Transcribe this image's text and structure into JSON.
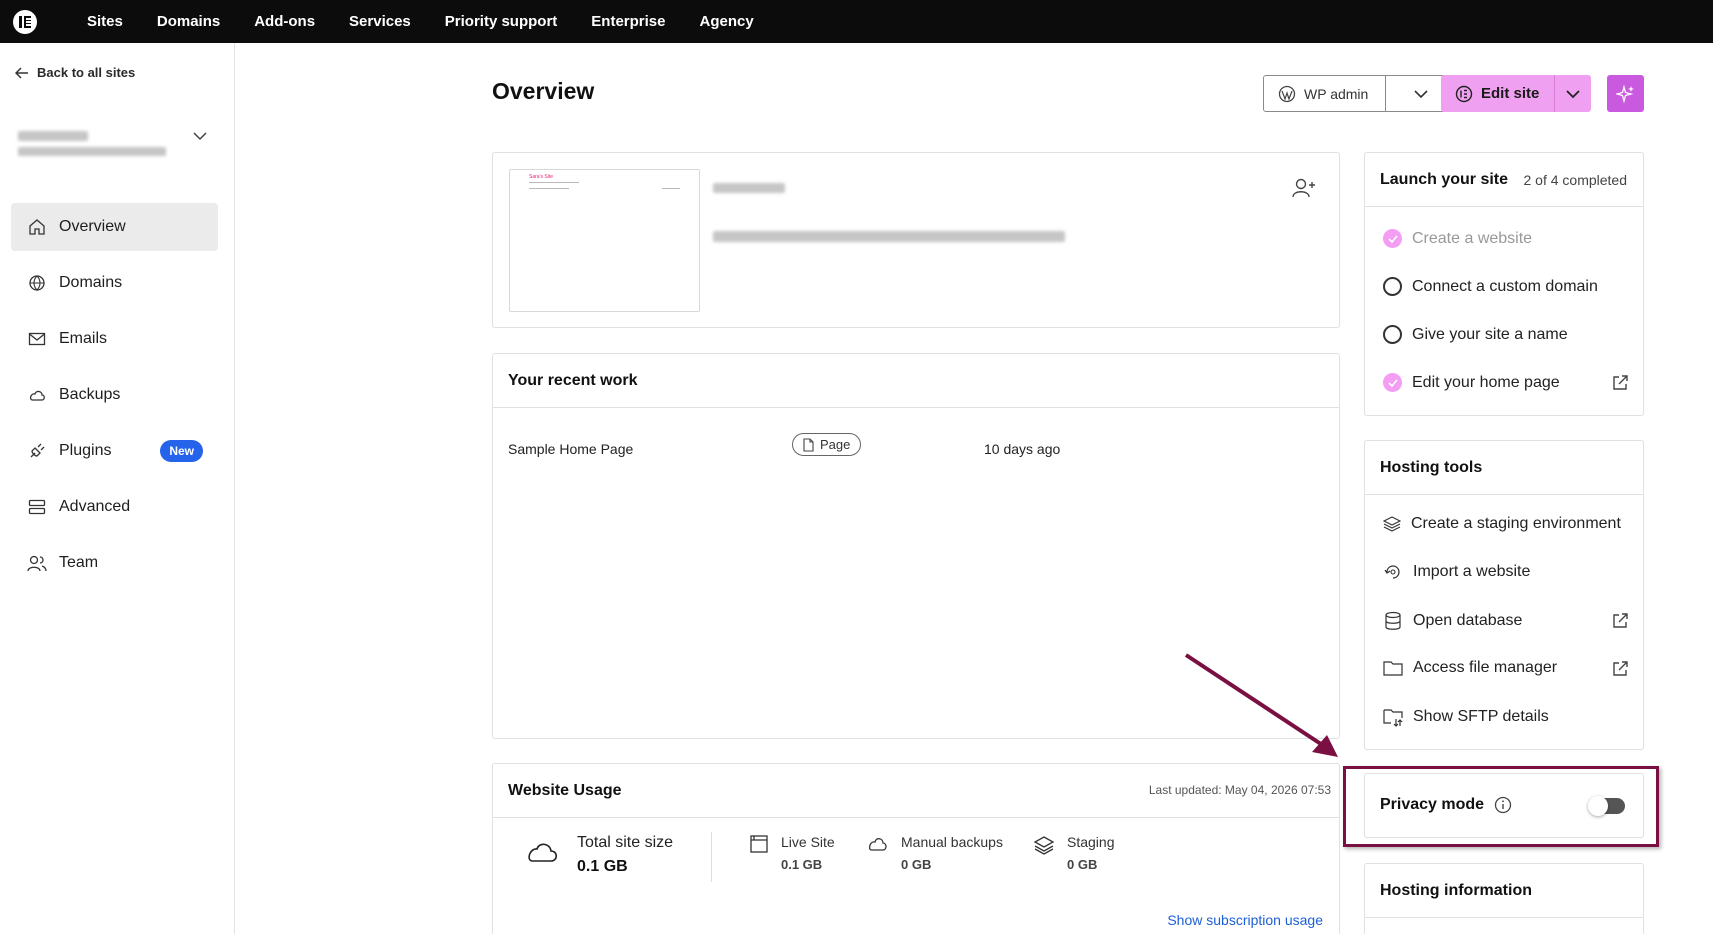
{
  "topnav": {
    "items": [
      "Sites",
      "Domains",
      "Add-ons",
      "Services",
      "Priority support",
      "Enterprise",
      "Agency"
    ]
  },
  "sidebar": {
    "back_label": "Back to all sites",
    "items": [
      {
        "label": "Overview",
        "icon": "home-icon",
        "active": true
      },
      {
        "label": "Domains",
        "icon": "globe-icon"
      },
      {
        "label": "Emails",
        "icon": "mail-icon"
      },
      {
        "label": "Backups",
        "icon": "cloud-backup-icon"
      },
      {
        "label": "Plugins",
        "icon": "plug-icon",
        "badge": "New"
      },
      {
        "label": "Advanced",
        "icon": "server-icon"
      },
      {
        "label": "Team",
        "icon": "team-icon"
      }
    ]
  },
  "header": {
    "title": "Overview",
    "wp_admin_label": "WP admin",
    "edit_site_label": "Edit site"
  },
  "site_card": {
    "thumb_title": "Sara's Site"
  },
  "recent_work": {
    "title": "Your recent work",
    "rows": [
      {
        "name": "Sample Home Page",
        "type": "Page",
        "when": "10 days ago"
      }
    ]
  },
  "usage": {
    "title": "Website Usage",
    "updated": "Last updated: May 04, 2026 07:53",
    "total_label": "Total site size",
    "total_value": "0.1 GB",
    "items": [
      {
        "label": "Live Site",
        "value": "0.1 GB"
      },
      {
        "label": "Manual backups",
        "value": "0 GB"
      },
      {
        "label": "Staging",
        "value": "0 GB"
      }
    ],
    "link": "Show subscription usage"
  },
  "launch": {
    "title": "Launch your site",
    "count": "2 of 4 completed",
    "tasks": [
      {
        "label": "Create a website",
        "done": true
      },
      {
        "label": "Connect a custom domain",
        "done": false
      },
      {
        "label": "Give your site a name",
        "done": false
      },
      {
        "label": "Edit your home page",
        "done": true
      }
    ]
  },
  "tools": {
    "title": "Hosting tools",
    "items": [
      {
        "label": "Create a staging environment",
        "icon": "layers-icon"
      },
      {
        "label": "Import a website",
        "icon": "import-icon"
      },
      {
        "label": "Open database",
        "icon": "database-icon"
      },
      {
        "label": "Access file manager",
        "icon": "folder-icon"
      },
      {
        "label": "Show SFTP details",
        "icon": "sftp-folder-icon"
      }
    ]
  },
  "privacy": {
    "label": "Privacy mode",
    "enabled": false
  },
  "hosting_info": {
    "title": "Hosting information"
  },
  "colors": {
    "accent_pink": "#f0a0f0",
    "ai_purple": "#c95adf",
    "annotation": "#7a1041",
    "link_blue": "#1d5fd6",
    "badge_blue": "#2563eb"
  }
}
